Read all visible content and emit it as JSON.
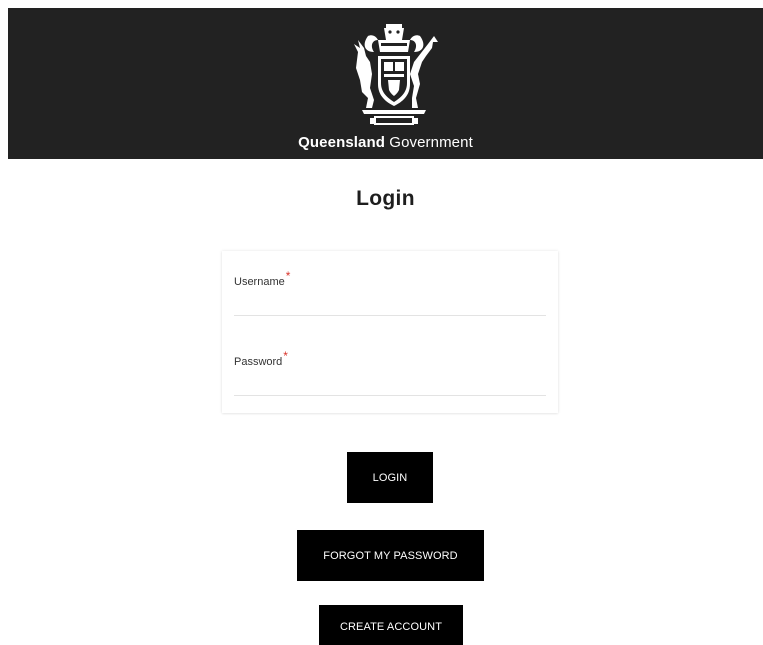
{
  "header": {
    "brand_bold": "Queensland",
    "brand_light": "Government",
    "crest_motto": "AUDAX AT FIDELIS",
    "background": "#222222"
  },
  "page_title": "Login",
  "form": {
    "username_label": "Username",
    "password_label": "Password",
    "required_marker": "*",
    "username_value": "",
    "password_value": "",
    "required_color": "#d9342b"
  },
  "buttons": {
    "login": "LOGIN",
    "forgot_password": "FORGOT MY PASSWORD",
    "create_account": "CREATE ACCOUNT"
  }
}
